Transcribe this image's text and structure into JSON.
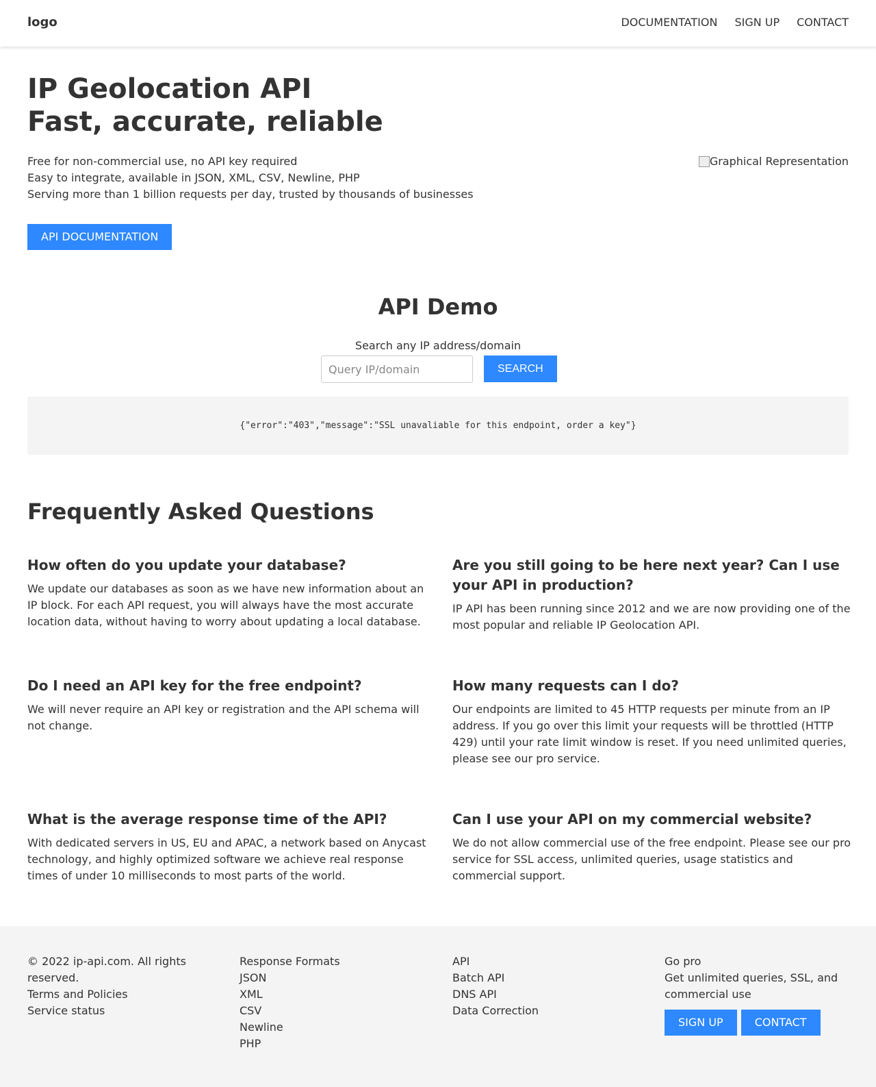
{
  "header": {
    "logo": "logo",
    "nav": [
      "DOCUMENTATION",
      "SIGN UP",
      "CONTACT"
    ]
  },
  "hero": {
    "title_line1": "IP Geolocation API",
    "title_line2": "Fast, accurate, reliable",
    "points": [
      "Free for non-commercial use, no API key required",
      "Easy to integrate, available in JSON, XML, CSV, Newline, PHP",
      "Serving more than 1 billion requests per day, trusted by thousands of businesses"
    ],
    "image_alt": "Graphical Representation",
    "button": "API DOCUMENTATION"
  },
  "demo": {
    "title": "API Demo",
    "label": "Search any IP address/domain",
    "placeholder": "Query IP/domain",
    "button": "SEARCH",
    "result": "{\"error\":\"403\",\"message\":\"SSL unavaliable for this endpoint, order a key\"}"
  },
  "faq": {
    "title": "Frequently Asked Questions",
    "items": [
      {
        "q": "How often do you update your database?",
        "a": "We update our databases as soon as we have new information about an IP block. For each API request, you will always have the most accurate location data, without having to worry about updating a local database."
      },
      {
        "q": "Are you still going to be here next year? Can I use your API in production?",
        "a": "IP API has been running since 2012 and we are now providing one of the most popular and reliable IP Geolocation API."
      },
      {
        "q": "Do I need an API key for the free endpoint?",
        "a": "We will never require an API key or registration and the API schema will not change."
      },
      {
        "q": "How many requests can I do?",
        "a": "Our endpoints are limited to 45 HTTP requests per minute from an IP address. If you go over this limit your requests will be throttled (HTTP 429) until your rate limit window is reset. If you need unlimited queries, please see our pro service."
      },
      {
        "q": "What is the average response time of the API?",
        "a": "With dedicated servers in US, EU and APAC, a network based on Anycast technology, and highly optimized software we achieve real response times of under 10 milliseconds to most parts of the world."
      },
      {
        "q": "Can I use your API on my commercial website?",
        "a": "We do not allow commercial use of the free endpoint. Please see our pro service for SSL access, unlimited queries, usage statistics and commercial support."
      }
    ]
  },
  "footer": {
    "col1": [
      "© 2022 ip-api.com. All rights reserved.",
      "Terms and Policies",
      "Service status"
    ],
    "col2": [
      "Response Formats",
      "JSON",
      "XML",
      "CSV",
      "Newline",
      "PHP"
    ],
    "col3": [
      "API",
      "Batch API",
      "DNS API",
      "Data Correction"
    ],
    "col4": {
      "title": "Go pro",
      "text": "Get unlimited queries, SSL, and commercial use",
      "signup": "SIGN UP",
      "contact": "CONTACT"
    }
  },
  "colors": {
    "accent": "#2e88ff",
    "text": "#333333",
    "panel": "#f4f4f4"
  }
}
